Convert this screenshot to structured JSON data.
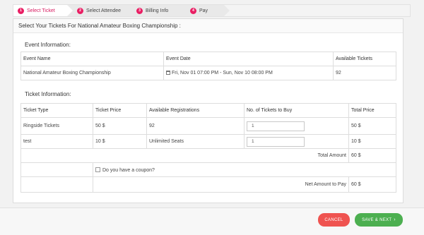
{
  "steps": [
    {
      "num": "1",
      "label": "Select Ticket"
    },
    {
      "num": "2",
      "label": "Select Attendee"
    },
    {
      "num": "3",
      "label": "Billing Info"
    },
    {
      "num": "4",
      "label": "Pay"
    }
  ],
  "panel_title": "Select Your Tickets For National Amateur Boxing Championship :",
  "event_section": {
    "label": "Event Information:",
    "headers": [
      "Event Name",
      "Event Date",
      "Available Tickets"
    ],
    "row": {
      "name": "National Amateur Boxing Championship",
      "date": "Fri, Nov 01 07:00 PM - Sun, Nov 10 08:00 PM",
      "available": "92"
    }
  },
  "ticket_section": {
    "label": "Ticket Information:",
    "headers": [
      "Ticket Type",
      "Ticket Price",
      "Available Registrations",
      "No. of Tickets to Buy",
      "Total Price"
    ],
    "rows": [
      {
        "type": "Ringside Tickets",
        "price": "50 $",
        "available": "92",
        "qty": "1",
        "total": "50 $"
      },
      {
        "type": "test",
        "price": "10 $",
        "available": "Unlimited Seats",
        "qty": "1",
        "total": "10 $"
      }
    ],
    "total_label": "Total Amount",
    "total_value": "60 $",
    "coupon_label": "Do you have a coupon?",
    "net_label": "Net Amount to Pay",
    "net_value": "60 $"
  },
  "buttons": {
    "cancel": "CANCEL",
    "next": "SAVE & NEXT",
    "next_icon": "chevron-right-icon"
  },
  "colors": {
    "accent": "#e91e63",
    "cancel": "#ef5350",
    "next": "#4caf50"
  }
}
